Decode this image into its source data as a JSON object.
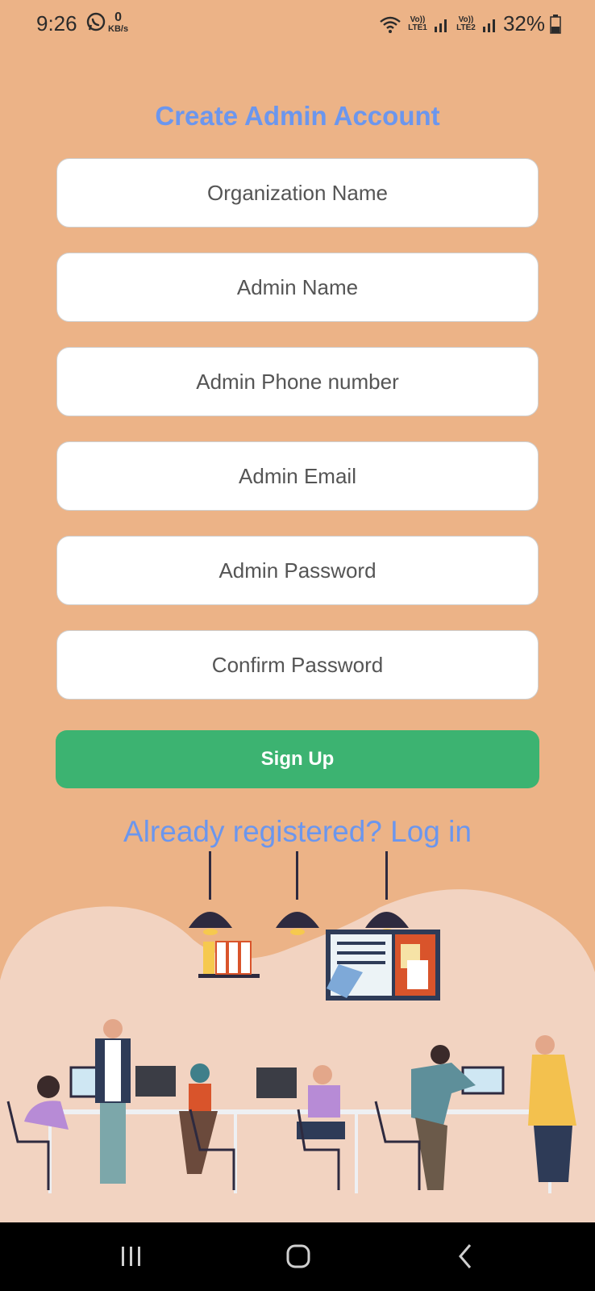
{
  "status_bar": {
    "time": "9:26",
    "data_rate_value": "0",
    "data_rate_unit": "KB/s",
    "sim1_label": "Vo)) LTE1",
    "sim2_label": "Vo)) LTE2",
    "battery_percent": "32%",
    "icons": [
      "whatsapp-icon",
      "wifi-icon",
      "signal-icon",
      "battery-icon"
    ]
  },
  "form": {
    "title": "Create Admin Account",
    "fields": {
      "organization_name": "Organization Name",
      "admin_name": "Admin Name",
      "admin_phone": "Admin Phone number",
      "admin_email": "Admin Email",
      "admin_password": "Admin Password",
      "confirm_password": "Confirm Password"
    },
    "signup_label": "Sign Up",
    "login_link": "Already registered? Log in"
  },
  "colors": {
    "background": "#ecb387",
    "accent_text": "#6b96ee",
    "signup_button": "#3cb371"
  },
  "nav_bar": {
    "buttons": [
      "recent-apps-icon",
      "home-icon",
      "back-icon"
    ]
  }
}
